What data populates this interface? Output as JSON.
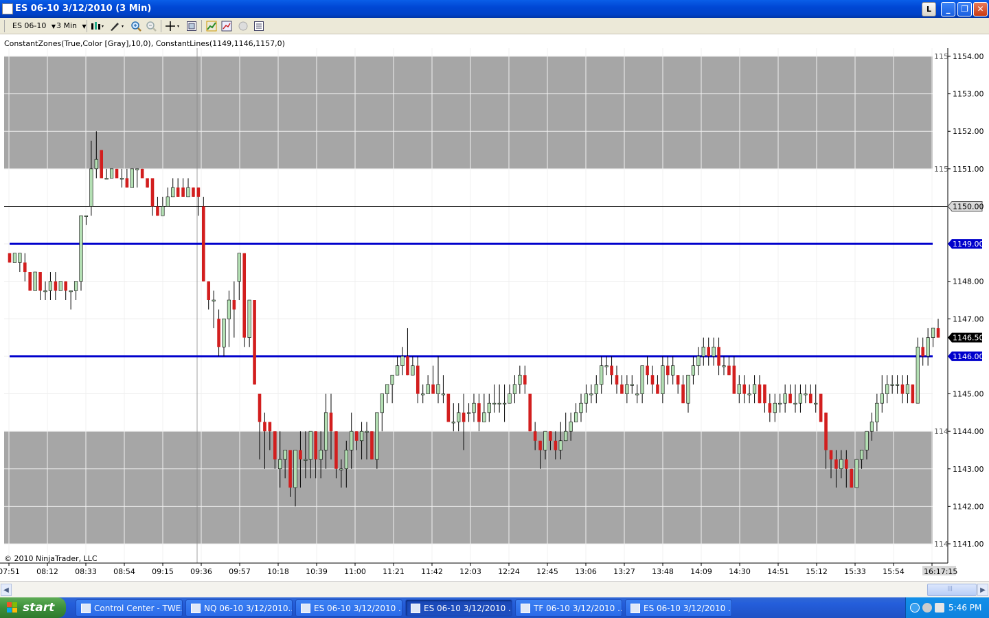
{
  "window": {
    "title": "ES 06-10  3/12/2010 (3 Min)",
    "buttons": {
      "l": "L",
      "minimize": "_",
      "maximize": "❐",
      "close": "✕"
    }
  },
  "toolbar": {
    "instrument": "ES 06-10",
    "interval": "3 Min",
    "icons": [
      "bar-type-icon",
      "drawing-tool-icon",
      "zoom-in-icon",
      "zoom-out-icon",
      "crosshair-icon",
      "properties-icon",
      "instrument-icon",
      "indicators-icon",
      "strategy-icon",
      "data-box-icon"
    ]
  },
  "chart": {
    "indicator_label": "ConstantZones(True,Color [Gray],10,0), ConstantLines(1149,1146,1157,0)",
    "copyright": "© 2010 NinjaTrader, LLC",
    "time_labels": [
      "07:51",
      "08:12",
      "08:33",
      "08:54",
      "09:15",
      "09:36",
      "09:57",
      "10:18",
      "10:39",
      "11:00",
      "11:21",
      "11:42",
      "12:03",
      "12:24",
      "12:45",
      "13:06",
      "13:27",
      "13:48",
      "14:09",
      "14:30",
      "14:51",
      "15:12",
      "15:33",
      "15:54",
      "16:17:15"
    ],
    "price_labels": [
      "1154.00",
      "1153.00",
      "1152.00",
      "1151.00",
      "1150.00",
      "1149.00",
      "1148.00",
      "1147.00",
      "1146.50",
      "1146.00",
      "1145.00",
      "1144.00",
      "1143.00",
      "1142.00",
      "1141.00"
    ],
    "zone_edge_labels": [
      "115",
      "115",
      "114",
      "114"
    ],
    "markers": {
      "horizontal_line": "1150.00",
      "constant_line_1": "1149.00",
      "constant_line_2": "1146.00",
      "last_price": "1146.50"
    }
  },
  "chart_data": {
    "type": "candlestick",
    "interval": "3 Min",
    "instrument": "ES 06-10",
    "ylim": [
      1140.75,
      1154.25
    ],
    "grid": true,
    "zones": [
      {
        "from": 1151.0,
        "to": 1154.0,
        "color": "#a6a6a6"
      },
      {
        "from": 1141.0,
        "to": 1144.0,
        "color": "#a6a6a6"
      }
    ],
    "constant_lines": [
      1149,
      1146
    ],
    "horizontal_line": 1150,
    "last_price": 1146.5,
    "candles": [
      [
        1148.75,
        1148.75,
        1148.5,
        1148.5
      ],
      [
        1148.5,
        1148.75,
        1148.5,
        1148.75
      ],
      [
        1148.5,
        1148.75,
        1148.25,
        1148.75
      ],
      [
        1148.5,
        1148.75,
        1148.0,
        1148.25
      ],
      [
        1148.25,
        1148.25,
        1147.75,
        1147.75
      ],
      [
        1147.75,
        1148.25,
        1147.75,
        1148.25
      ],
      [
        1148.25,
        1148.25,
        1147.5,
        1147.75
      ],
      [
        1147.75,
        1148.0,
        1147.5,
        1147.75
      ],
      [
        1147.75,
        1148.25,
        1147.5,
        1148.0
      ],
      [
        1148.0,
        1148.25,
        1147.5,
        1147.75
      ],
      [
        1147.75,
        1148.0,
        1147.75,
        1148.0
      ],
      [
        1148.0,
        1148.0,
        1147.5,
        1147.75
      ],
      [
        1147.75,
        1147.75,
        1147.25,
        1147.75
      ],
      [
        1147.75,
        1148.0,
        1147.5,
        1148.0
      ],
      [
        1148.0,
        1149.75,
        1147.75,
        1149.75
      ],
      [
        1149.75,
        1149.75,
        1149.5,
        1149.75
      ],
      [
        1150.0,
        1151.75,
        1149.75,
        1151.0
      ],
      [
        1151.0,
        1152.0,
        1150.75,
        1151.25
      ],
      [
        1151.5,
        1151.5,
        1150.75,
        1150.75
      ],
      [
        1150.75,
        1151.0,
        1150.75,
        1150.75
      ],
      [
        1150.75,
        1151.0,
        1150.75,
        1151.0
      ],
      [
        1151.0,
        1151.0,
        1150.75,
        1150.75
      ],
      [
        1150.75,
        1151.0,
        1150.5,
        1150.75
      ],
      [
        1150.75,
        1151.0,
        1150.5,
        1150.5
      ],
      [
        1150.5,
        1151.0,
        1150.5,
        1151.0
      ],
      [
        1151.0,
        1151.0,
        1150.5,
        1151.0
      ],
      [
        1151.0,
        1151.0,
        1150.75,
        1150.75
      ],
      [
        1150.75,
        1150.75,
        1150.5,
        1150.5
      ],
      [
        1150.75,
        1150.75,
        1149.75,
        1150.0
      ],
      [
        1150.0,
        1150.25,
        1149.75,
        1149.75
      ],
      [
        1149.75,
        1150.25,
        1149.75,
        1150.0
      ],
      [
        1150.0,
        1150.5,
        1150.0,
        1150.25
      ],
      [
        1150.25,
        1150.75,
        1150.25,
        1150.5
      ],
      [
        1150.5,
        1150.75,
        1150.25,
        1150.25
      ],
      [
        1150.5,
        1150.75,
        1150.25,
        1150.25
      ],
      [
        1150.25,
        1150.75,
        1150.25,
        1150.5
      ],
      [
        1150.5,
        1150.5,
        1150.25,
        1150.25
      ],
      [
        1150.5,
        1150.5,
        1149.75,
        1150.25
      ],
      [
        1150.0,
        1150.25,
        1148.0,
        1148.0
      ],
      [
        1148.0,
        1148.0,
        1147.25,
        1147.5
      ],
      [
        1147.5,
        1147.75,
        1146.75,
        1147.5
      ],
      [
        1147.0,
        1147.25,
        1146.0,
        1146.25
      ],
      [
        1146.25,
        1147.0,
        1146.0,
        1147.0
      ],
      [
        1147.0,
        1147.75,
        1146.25,
        1147.5
      ],
      [
        1147.5,
        1148.0,
        1146.5,
        1147.25
      ],
      [
        1148.0,
        1148.75,
        1147.5,
        1148.75
      ],
      [
        1148.75,
        1148.75,
        1146.25,
        1146.5
      ],
      [
        1146.5,
        1147.5,
        1146.25,
        1147.5
      ],
      [
        1147.5,
        1147.5,
        1145.25,
        1145.25
      ],
      [
        1145.0,
        1145.0,
        1143.25,
        1144.25
      ],
      [
        1144.25,
        1144.5,
        1143.0,
        1144.0
      ],
      [
        1144.25,
        1144.25,
        1143.5,
        1144.0
      ],
      [
        1144.0,
        1144.0,
        1143.0,
        1143.25
      ],
      [
        1143.0,
        1144.0,
        1142.5,
        1143.25
      ],
      [
        1143.25,
        1143.5,
        1142.75,
        1143.5
      ],
      [
        1143.5,
        1143.5,
        1142.25,
        1142.5
      ],
      [
        1142.5,
        1143.5,
        1142.0,
        1143.5
      ],
      [
        1143.5,
        1144.0,
        1142.5,
        1143.25
      ],
      [
        1143.25,
        1144.0,
        1142.75,
        1143.25
      ],
      [
        1143.25,
        1144.0,
        1142.75,
        1144.0
      ],
      [
        1144.0,
        1144.0,
        1142.75,
        1143.25
      ],
      [
        1143.25,
        1144.0,
        1142.75,
        1143.5
      ],
      [
        1143.5,
        1145.0,
        1143.0,
        1144.5
      ],
      [
        1144.5,
        1145.0,
        1143.25,
        1144.0
      ],
      [
        1144.0,
        1144.0,
        1142.75,
        1143.0
      ],
      [
        1143.0,
        1143.25,
        1142.5,
        1143.0
      ],
      [
        1143.0,
        1143.75,
        1142.5,
        1143.5
      ],
      [
        1143.5,
        1144.5,
        1143.0,
        1144.0
      ],
      [
        1144.0,
        1144.0,
        1143.5,
        1143.75
      ],
      [
        1143.75,
        1144.25,
        1143.25,
        1144.0
      ],
      [
        1144.0,
        1144.25,
        1143.25,
        1144.0
      ],
      [
        1144.0,
        1144.0,
        1143.25,
        1143.25
      ],
      [
        1143.25,
        1144.5,
        1143.0,
        1144.5
      ],
      [
        1144.5,
        1145.0,
        1144.0,
        1145.0
      ],
      [
        1145.0,
        1145.25,
        1144.75,
        1145.25
      ],
      [
        1145.25,
        1145.5,
        1144.75,
        1145.5
      ],
      [
        1145.5,
        1146.0,
        1145.5,
        1145.75
      ],
      [
        1145.75,
        1146.25,
        1145.5,
        1146.0
      ],
      [
        1146.0,
        1146.75,
        1145.5,
        1145.5
      ],
      [
        1145.5,
        1146.0,
        1145.5,
        1145.75
      ],
      [
        1145.75,
        1146.0,
        1144.75,
        1145.0
      ],
      [
        1145.0,
        1145.25,
        1144.75,
        1145.0
      ],
      [
        1145.0,
        1145.5,
        1145.0,
        1145.25
      ],
      [
        1145.25,
        1145.75,
        1145.0,
        1145.0
      ],
      [
        1145.0,
        1146.0,
        1144.75,
        1145.25
      ],
      [
        1145.0,
        1145.5,
        1144.75,
        1145.0
      ],
      [
        1145.0,
        1145.0,
        1144.25,
        1144.25
      ],
      [
        1144.25,
        1144.75,
        1144.0,
        1144.25
      ],
      [
        1144.25,
        1144.75,
        1144.0,
        1144.5
      ],
      [
        1144.5,
        1145.0,
        1143.5,
        1144.25
      ],
      [
        1144.5,
        1144.75,
        1144.25,
        1144.5
      ],
      [
        1144.5,
        1145.0,
        1144.25,
        1144.75
      ],
      [
        1144.75,
        1145.0,
        1144.0,
        1144.25
      ],
      [
        1144.25,
        1145.0,
        1144.25,
        1144.5
      ],
      [
        1144.5,
        1145.0,
        1144.25,
        1144.75
      ],
      [
        1144.75,
        1145.25,
        1144.5,
        1144.75
      ],
      [
        1144.75,
        1145.25,
        1144.5,
        1144.75
      ],
      [
        1144.75,
        1145.25,
        1144.25,
        1144.75
      ],
      [
        1144.75,
        1145.25,
        1144.75,
        1145.0
      ],
      [
        1145.0,
        1145.5,
        1144.75,
        1145.25
      ],
      [
        1145.25,
        1145.75,
        1145.0,
        1145.5
      ],
      [
        1145.5,
        1145.75,
        1145.0,
        1145.25
      ],
      [
        1145.0,
        1145.0,
        1144.0,
        1144.0
      ],
      [
        1144.0,
        1144.25,
        1143.5,
        1143.75
      ],
      [
        1143.75,
        1143.75,
        1143.0,
        1143.5
      ],
      [
        1143.5,
        1144.0,
        1143.25,
        1144.0
      ],
      [
        1144.0,
        1144.0,
        1143.5,
        1143.75
      ],
      [
        1143.75,
        1144.0,
        1143.25,
        1143.5
      ],
      [
        1143.5,
        1144.25,
        1143.25,
        1143.75
      ],
      [
        1143.75,
        1144.5,
        1143.75,
        1144.0
      ],
      [
        1144.0,
        1144.5,
        1143.75,
        1144.25
      ],
      [
        1144.25,
        1144.75,
        1144.25,
        1144.5
      ],
      [
        1144.5,
        1145.0,
        1144.25,
        1144.75
      ],
      [
        1144.75,
        1145.25,
        1144.5,
        1145.0
      ],
      [
        1145.0,
        1145.25,
        1144.75,
        1145.0
      ],
      [
        1145.0,
        1145.5,
        1144.75,
        1145.25
      ],
      [
        1145.25,
        1146.0,
        1145.0,
        1145.75
      ],
      [
        1145.75,
        1146.0,
        1145.5,
        1145.75
      ],
      [
        1145.75,
        1146.0,
        1145.25,
        1145.5
      ],
      [
        1145.5,
        1145.75,
        1145.0,
        1145.25
      ],
      [
        1145.25,
        1145.5,
        1145.0,
        1145.0
      ],
      [
        1145.0,
        1145.5,
        1144.75,
        1145.25
      ],
      [
        1145.25,
        1145.5,
        1145.0,
        1145.25
      ],
      [
        1145.0,
        1145.25,
        1144.75,
        1145.0
      ],
      [
        1145.0,
        1145.75,
        1144.75,
        1145.75
      ],
      [
        1145.75,
        1146.0,
        1145.25,
        1145.5
      ],
      [
        1145.5,
        1145.75,
        1145.0,
        1145.25
      ],
      [
        1145.25,
        1145.5,
        1145.0,
        1145.0
      ],
      [
        1145.0,
        1146.0,
        1144.75,
        1145.75
      ],
      [
        1145.75,
        1146.0,
        1145.25,
        1145.5
      ],
      [
        1145.5,
        1146.0,
        1145.25,
        1145.75
      ],
      [
        1145.5,
        1145.5,
        1145.0,
        1145.25
      ],
      [
        1145.25,
        1145.5,
        1144.75,
        1144.75
      ],
      [
        1144.75,
        1145.5,
        1144.5,
        1145.5
      ],
      [
        1145.5,
        1146.0,
        1145.25,
        1145.75
      ],
      [
        1145.75,
        1146.25,
        1145.5,
        1146.0
      ],
      [
        1146.0,
        1146.5,
        1145.75,
        1146.25
      ],
      [
        1146.25,
        1146.5,
        1145.75,
        1146.0
      ],
      [
        1146.0,
        1146.5,
        1145.75,
        1146.25
      ],
      [
        1146.25,
        1146.5,
        1145.5,
        1145.75
      ],
      [
        1145.75,
        1146.0,
        1145.5,
        1145.75
      ],
      [
        1145.75,
        1146.0,
        1145.5,
        1145.5
      ],
      [
        1145.75,
        1146.0,
        1145.0,
        1145.0
      ],
      [
        1145.0,
        1145.5,
        1144.75,
        1145.25
      ],
      [
        1145.25,
        1145.5,
        1144.75,
        1145.0
      ],
      [
        1145.0,
        1145.25,
        1144.75,
        1145.0
      ],
      [
        1145.0,
        1145.5,
        1144.75,
        1145.25
      ],
      [
        1145.25,
        1145.5,
        1144.75,
        1144.75
      ],
      [
        1145.25,
        1145.25,
        1144.5,
        1144.75
      ],
      [
        1144.75,
        1145.0,
        1144.25,
        1144.5
      ],
      [
        1144.5,
        1145.0,
        1144.25,
        1144.75
      ],
      [
        1144.75,
        1145.0,
        1144.5,
        1144.75
      ],
      [
        1144.75,
        1145.25,
        1144.5,
        1145.0
      ],
      [
        1145.0,
        1145.25,
        1144.75,
        1144.75
      ],
      [
        1144.75,
        1145.25,
        1144.5,
        1144.75
      ],
      [
        1144.75,
        1145.25,
        1144.5,
        1145.0
      ],
      [
        1145.0,
        1145.25,
        1144.75,
        1145.0
      ],
      [
        1145.0,
        1145.25,
        1144.75,
        1144.75
      ],
      [
        1144.75,
        1145.25,
        1144.5,
        1144.75
      ],
      [
        1145.0,
        1145.0,
        1144.25,
        1144.25
      ],
      [
        1144.5,
        1144.5,
        1143.0,
        1143.5
      ],
      [
        1143.5,
        1143.5,
        1142.75,
        1143.25
      ],
      [
        1143.25,
        1143.5,
        1142.5,
        1143.0
      ],
      [
        1143.0,
        1143.5,
        1142.75,
        1143.25
      ],
      [
        1143.25,
        1143.5,
        1142.5,
        1143.0
      ],
      [
        1143.0,
        1143.0,
        1142.5,
        1142.5
      ],
      [
        1142.5,
        1143.25,
        1142.5,
        1143.25
      ],
      [
        1143.25,
        1143.5,
        1143.0,
        1143.5
      ],
      [
        1143.5,
        1144.0,
        1143.25,
        1144.0
      ],
      [
        1144.0,
        1144.5,
        1143.75,
        1144.25
      ],
      [
        1144.25,
        1145.0,
        1144.0,
        1144.75
      ],
      [
        1144.75,
        1145.5,
        1144.5,
        1145.0
      ],
      [
        1145.0,
        1145.5,
        1144.75,
        1145.25
      ],
      [
        1145.25,
        1145.5,
        1145.0,
        1145.25
      ],
      [
        1145.25,
        1145.5,
        1145.0,
        1145.25
      ],
      [
        1145.25,
        1145.5,
        1144.75,
        1145.0
      ],
      [
        1145.0,
        1145.5,
        1144.75,
        1145.25
      ],
      [
        1145.25,
        1145.25,
        1144.75,
        1144.75
      ],
      [
        1144.75,
        1146.5,
        1144.75,
        1146.25
      ],
      [
        1146.25,
        1146.5,
        1145.75,
        1146.0
      ],
      [
        1146.0,
        1146.75,
        1145.75,
        1146.5
      ],
      [
        1146.5,
        1146.75,
        1146.25,
        1146.75
      ],
      [
        1146.75,
        1147.0,
        1146.5,
        1146.5
      ]
    ]
  },
  "scrollbar": {
    "left_arrow": "◀",
    "right_arrow": "▶",
    "grip": "|||"
  },
  "taskbar": {
    "start_label": "start",
    "tasks": [
      "Control Center - TWE...",
      "NQ 06-10  3/12/2010...",
      "ES 06-10  3/12/2010 ...",
      "ES 06-10  3/12/2010 ...",
      "TF 06-10  3/12/2010 ...",
      "ES 06-10  3/12/2010 ..."
    ],
    "active_index": 3,
    "clock": "5:46 PM",
    "colors": {
      "taskbar": "#245edb",
      "start": "#3c8f3a",
      "tray": "#0f82de"
    }
  },
  "colors": {
    "up_candle": "#b4e0b4",
    "down_candle": "#d21e1e",
    "zone": "#a6a6a6",
    "constant_line": "#0000cc",
    "label_bg_blue": "#0000cc",
    "label_bg_black": "#000000"
  }
}
